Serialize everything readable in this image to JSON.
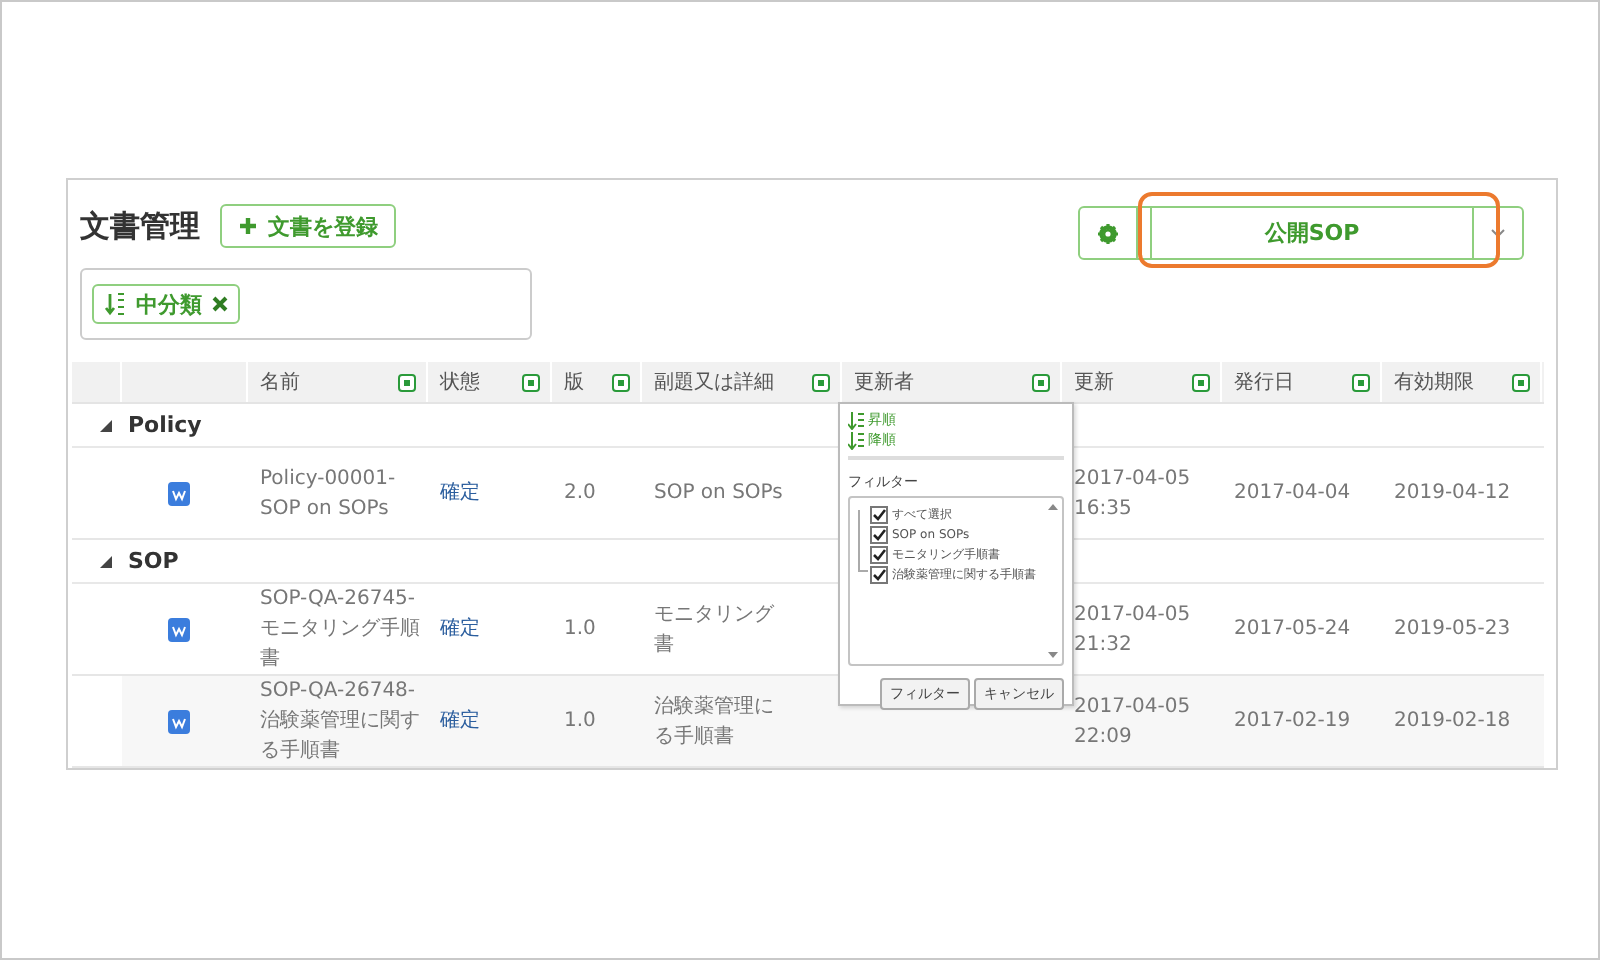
{
  "title": "文書管理",
  "register_button": "文書を登録",
  "view_select": {
    "value": "公開SOP"
  },
  "sort_chip": {
    "label": "中分類"
  },
  "columns": [
    "名前",
    "状態",
    "版",
    "副題又は詳細",
    "更新者",
    "更新",
    "発行日",
    "有効期限"
  ],
  "groups": [
    {
      "label": "Policy",
      "expanded": true,
      "rows": [
        {
          "name_lines": [
            "Policy-00001-",
            "SOP on SOPs"
          ],
          "status": "確定",
          "version": "2.0",
          "detail_lines": [
            "SOP on SOPs"
          ],
          "updated_lines": [
            "2017-04-05",
            "16:35"
          ],
          "issued": "2017-04-04",
          "expires": "2019-04-12"
        }
      ]
    },
    {
      "label": "SOP",
      "expanded": true,
      "rows": [
        {
          "name_lines": [
            "SOP-QA-26745-",
            "モニタリング手順",
            "書"
          ],
          "status": "確定",
          "version": "1.0",
          "detail_lines": [
            "モニタリング",
            "書"
          ],
          "updated_lines": [
            "2017-04-05",
            "21:32"
          ],
          "issued": "2017-05-24",
          "expires": "2019-05-23"
        },
        {
          "name_lines": [
            "SOP-QA-26748-",
            "治験薬管理に関す",
            "る手順書"
          ],
          "status": "確定",
          "version": "1.0",
          "detail_lines": [
            "治験薬管理に",
            "る手順書"
          ],
          "updated_lines": [
            "2017-04-05",
            "22:09"
          ],
          "issued": "2017-02-19",
          "expires": "2019-02-18"
        }
      ]
    }
  ],
  "filter_popup": {
    "sort_asc": "昇順",
    "sort_desc": "降順",
    "filter_label": "フィルター",
    "options": [
      {
        "label": "すべて選択",
        "checked": true
      },
      {
        "label": "SOP on SOPs",
        "checked": true
      },
      {
        "label": "モニタリング手順書",
        "checked": true
      },
      {
        "label": "治験薬管理に関する手順書",
        "checked": true
      }
    ],
    "apply_button": "フィルター",
    "cancel_button": "キャンセル"
  }
}
